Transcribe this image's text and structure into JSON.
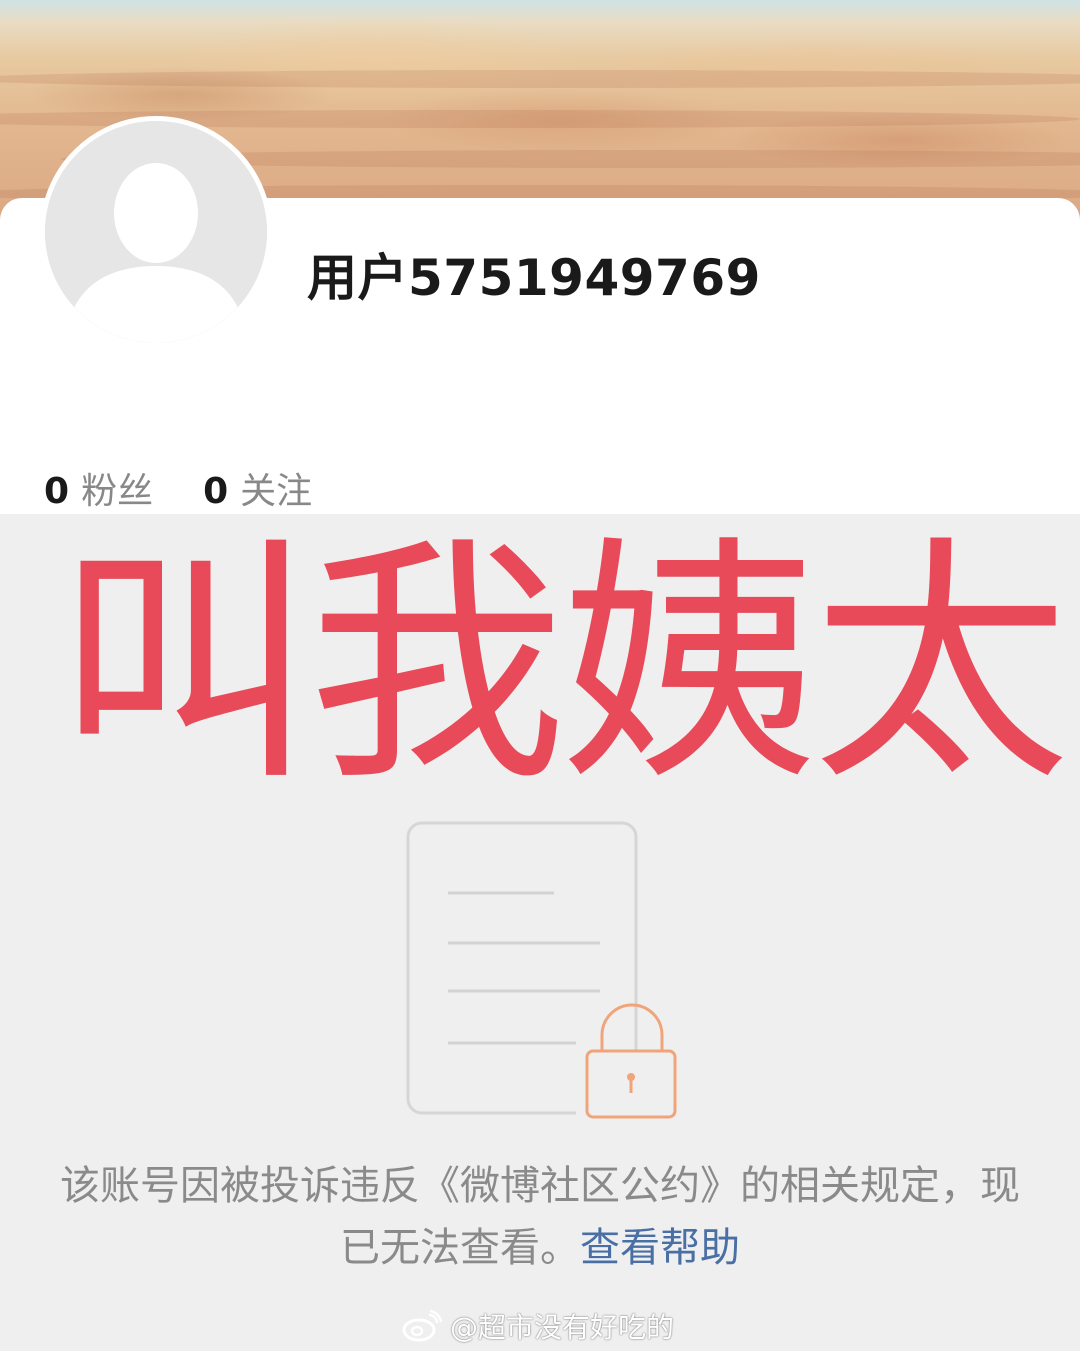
{
  "profile": {
    "username": "用户5751949769",
    "stats": [
      {
        "value": "0",
        "label": "粉丝"
      },
      {
        "value": "0",
        "label": "关注"
      }
    ]
  },
  "overlay": {
    "text": "叫我姨太",
    "color": "#e84a5a"
  },
  "notice": {
    "text": "该账号因被投诉违反《微博社区公约》的相关规定，现已无法查看。",
    "help_link": "查看帮助",
    "link_color": "#4a6fa5"
  },
  "watermark": {
    "text": "@超市没有好吃的",
    "icon": "weibo-icon"
  },
  "icons": {
    "avatar": "default-avatar-icon",
    "blocked": "locked-document-icon"
  }
}
